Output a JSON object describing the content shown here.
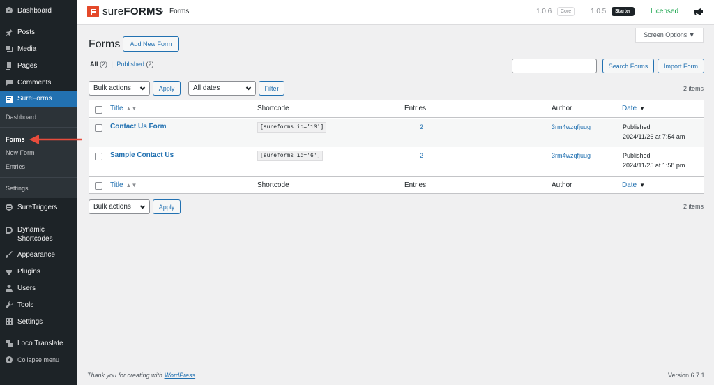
{
  "sidebar": {
    "items": [
      {
        "label": "Dashboard",
        "icon": "dashboard-icon"
      },
      {
        "label": "Posts",
        "icon": "pin-icon"
      },
      {
        "label": "Media",
        "icon": "media-icon"
      },
      {
        "label": "Pages",
        "icon": "pages-icon"
      },
      {
        "label": "Comments",
        "icon": "comment-icon"
      },
      {
        "label": "SureForms",
        "icon": "sureforms-icon"
      },
      {
        "label": "SureTriggers",
        "icon": "suretriggers-icon"
      },
      {
        "label": "Dynamic Shortcodes",
        "icon": "dynamic-shortcodes-icon"
      },
      {
        "label": "Appearance",
        "icon": "brush-icon"
      },
      {
        "label": "Plugins",
        "icon": "plugin-icon"
      },
      {
        "label": "Users",
        "icon": "user-icon"
      },
      {
        "label": "Tools",
        "icon": "wrench-icon"
      },
      {
        "label": "Settings",
        "icon": "settings-icon"
      },
      {
        "label": "Loco Translate",
        "icon": "translate-icon"
      },
      {
        "label": "Collapse menu",
        "icon": "collapse-icon"
      }
    ],
    "submenu": [
      "Dashboard",
      "Forms",
      "New Form",
      "Entries",
      "Settings"
    ]
  },
  "header": {
    "brand_prefix": "sure",
    "brand_suffix": "FORMS",
    "breadcrumb_sep": "›",
    "breadcrumb": "Forms",
    "version_core": "1.0.6",
    "badge_core": "Core",
    "version_starter": "1.0.5",
    "badge_starter": "Starter",
    "license_status": "Licensed"
  },
  "screen_options": "Screen Options ▼",
  "page": {
    "title": "Forms",
    "add_new": "Add New Form",
    "filter_all": "All",
    "filter_all_count": "(2)",
    "filter_sep": "|",
    "filter_published": "Published",
    "filter_published_count": "(2)",
    "search_button": "Search Forms",
    "import_button": "Import Form",
    "bulk_actions": "Bulk actions",
    "apply": "Apply",
    "all_dates": "All dates",
    "filter": "Filter",
    "items_count": "2 items"
  },
  "table": {
    "columns": {
      "title": "Title",
      "shortcode": "Shortcode",
      "entries": "Entries",
      "author": "Author",
      "date": "Date"
    },
    "rows": [
      {
        "title": "Contact Us Form",
        "shortcode": "[sureforms id='13']",
        "entries": "2",
        "author": "3rm4wzqfjuug",
        "status": "Published",
        "date": "2024/11/26 at 7:54 am"
      },
      {
        "title": "Sample Contact Us",
        "shortcode": "[sureforms id='6']",
        "entries": "2",
        "author": "3rm4wzqfjuug",
        "status": "Published",
        "date": "2024/11/25 at 1:58 pm"
      }
    ]
  },
  "footer": {
    "thanks_prefix": "Thank you for creating with ",
    "thanks_link": "WordPress",
    "thanks_suffix": ".",
    "version": "Version 6.7.1"
  },
  "colors": {
    "accent": "#2271b1",
    "sidebar": "#1d2327",
    "brand": "#e4492a",
    "licensed": "#16a34a",
    "arrow": "#e74c3c"
  }
}
